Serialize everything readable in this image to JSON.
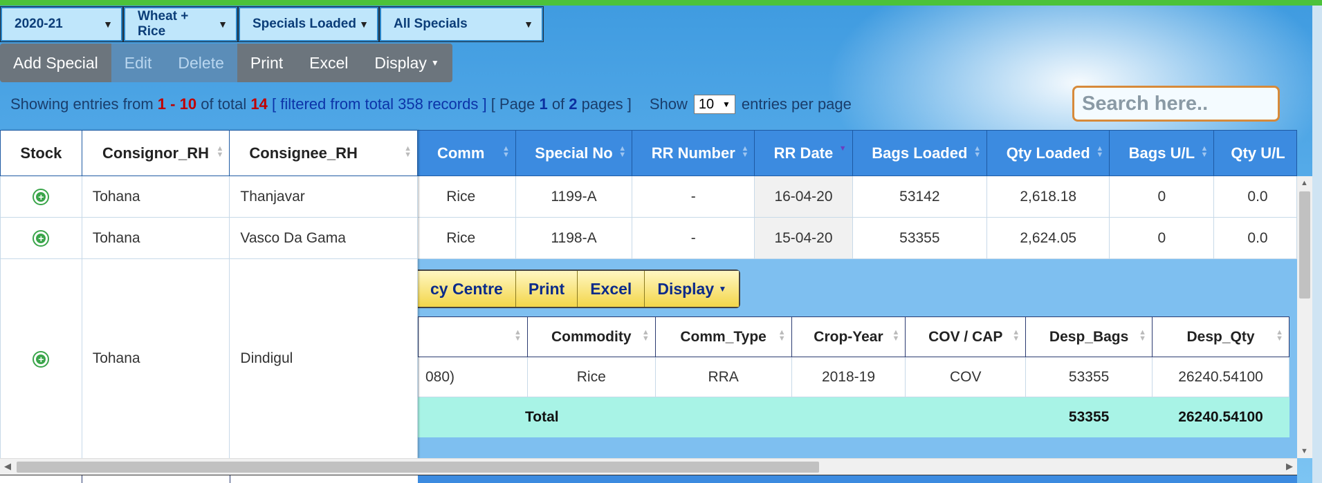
{
  "filters": {
    "year": "2020-21",
    "commodity": "Wheat + Rice",
    "status": "Specials Loaded",
    "specials": "All Specials"
  },
  "toolbar": {
    "add": "Add Special",
    "edit": "Edit",
    "delete": "Delete",
    "print": "Print",
    "excel": "Excel",
    "display": "Display"
  },
  "info": {
    "prefix": "Showing entries from",
    "from": "1",
    "dash": "-",
    "to": "10",
    "of_total": "of total",
    "total": "14",
    "filtered": "[ filtered from total 358 records ]",
    "page_open": "[ Page",
    "page": "1",
    "of": "of",
    "pages": "2",
    "pages_close": "pages ]",
    "show": "Show",
    "per_page": "10",
    "per_page_suffix": "entries per page"
  },
  "search": {
    "placeholder": "Search here.."
  },
  "main_table": {
    "fixed_headers": [
      "Stock",
      "Consignor_RH",
      "Consignee_RH"
    ],
    "headers": [
      "Comm",
      "Special No",
      "RR Number",
      "RR Date",
      "Bags Loaded",
      "Qty Loaded",
      "Bags U/L",
      "Qty U/L"
    ],
    "rows": [
      {
        "consignor": "Tohana",
        "consignee": "Thanjavar",
        "comm": "Rice",
        "special_no": "1199-A",
        "rr_number": "-",
        "rr_date": "16-04-20",
        "bags_loaded": "53142",
        "qty_loaded": "2,618.18",
        "bags_ul": "0",
        "qty_ul": "0.0"
      },
      {
        "consignor": "Tohana",
        "consignee": "Vasco Da Gama",
        "comm": "Rice",
        "special_no": "1198-A",
        "rr_number": "-",
        "rr_date": "15-04-20",
        "bags_loaded": "53355",
        "qty_loaded": "2,624.05",
        "bags_ul": "0",
        "qty_ul": "0.0"
      },
      {
        "consignor": "Tohana",
        "consignee": "Dindigul"
      }
    ]
  },
  "detail": {
    "toolbar": [
      "cy Centre",
      "Print",
      "Excel",
      "Display"
    ],
    "headers": [
      "",
      "Commodity",
      "Comm_Type",
      "Crop-Year",
      "COV / CAP",
      "Desp_Bags",
      "Desp_Qty"
    ],
    "row": {
      "first": "080)",
      "commodity": "Rice",
      "comm_type": "RRA",
      "crop_year": "2018-19",
      "cov_cap": "COV",
      "desp_bags": "53355",
      "desp_qty": "26240.54100"
    },
    "total": {
      "label": "Total",
      "desp_bags": "53355",
      "desp_qty": "26240.54100"
    }
  },
  "colors": {
    "header_blue": "#3c8be0",
    "select_bg": "#bfe6fb",
    "detail_bg": "#7ebff0",
    "total_row": "#a8f3e6",
    "toolbar_gray": "#6c757d",
    "yellow_toolbar": "#f6e06a"
  }
}
